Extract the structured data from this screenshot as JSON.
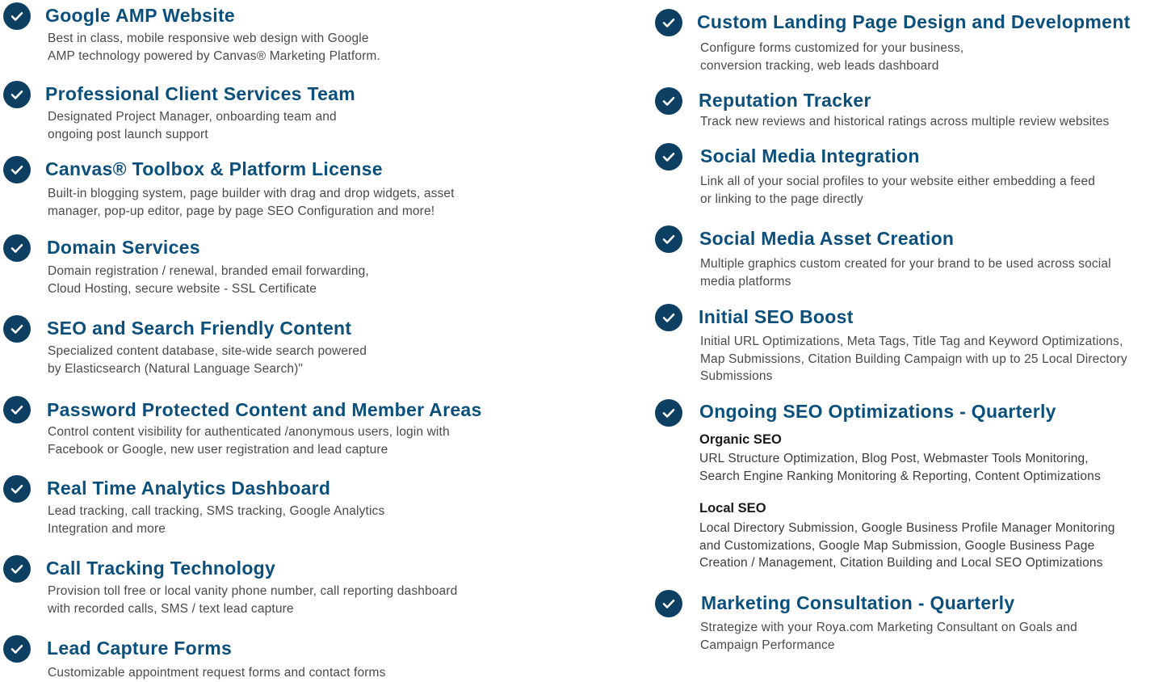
{
  "colors": {
    "check_bg": "#0d3f63",
    "title": "#0b4f7c",
    "text": "#4a4a4a"
  },
  "icon": "checkmark-circle-icon",
  "left_items": [
    {
      "title": "Google AMP Website",
      "desc": [
        "Best in class, mobile responsive web design with Google",
        "AMP technology powered by Canvas® Marketing Platform."
      ]
    },
    {
      "title": "Professional Client Services Team",
      "desc": [
        "Designated Project Manager, onboarding team and",
        "ongoing post launch support"
      ]
    },
    {
      "title": "Canvas® Toolbox & Platform License",
      "desc": [
        "Built-in blogging system, page builder with drag and drop widgets, asset",
        "manager, pop-up editor, page by page SEO Configuration and more!"
      ]
    },
    {
      "title": "Domain Services",
      "desc": [
        "Domain registration / renewal, branded email forwarding,",
        "Cloud Hosting, secure website - SSL Certificate"
      ]
    },
    {
      "title": "SEO and Search Friendly Content",
      "desc": [
        "Specialized content database, site-wide search powered",
        "by Elasticsearch (Natural Language Search)\""
      ]
    },
    {
      "title": "Password Protected Content and Member Areas",
      "desc": [
        "Control content visibility for authenticated /anonymous users, login with",
        "Facebook or Google, new user registration and lead capture"
      ]
    },
    {
      "title": "Real Time Analytics Dashboard",
      "desc": [
        "Lead tracking, call tracking, SMS tracking, Google Analytics",
        "Integration and more"
      ]
    },
    {
      "title": "Call Tracking Technology",
      "desc": [
        "Provision toll free or local vanity phone number, call reporting dashboard",
        "with recorded calls, SMS / text lead capture"
      ]
    },
    {
      "title": "Lead Capture Forms",
      "desc": [
        "Customizable appointment request forms and contact forms"
      ]
    }
  ],
  "right_items": [
    {
      "title": "Custom Landing Page Design and Development",
      "desc": [
        "Configure forms customized for your business,",
        "conversion tracking, web leads dashboard"
      ]
    },
    {
      "title": "Reputation Tracker",
      "desc": [
        "Track new reviews and historical ratings across multiple review websites"
      ]
    },
    {
      "title": "Social Media Integration",
      "desc": [
        "Link all of your social profiles to your website either embedding a feed",
        "or linking to the page directly"
      ]
    },
    {
      "title": "Social Media Asset Creation",
      "desc": [
        "Multiple graphics custom created for your brand to be used across social",
        "media platforms"
      ]
    },
    {
      "title": "Initial SEO Boost",
      "desc": [
        "Initial URL Optimizations, Meta Tags, Title Tag and Keyword Optimizations,",
        "Map Submissions, Citation Building Campaign with up to 25 Local Directory",
        "Submissions"
      ]
    },
    {
      "title": "Ongoing SEO Optimizations - Quarterly",
      "desc": []
    },
    {
      "title": "Marketing Consultation - Quarterly",
      "desc": [
        "Strategize with your Roya.com Marketing Consultant on Goals and",
        "Campaign Performance"
      ]
    }
  ],
  "ongoing_seo": {
    "organic": {
      "title": "Organic SEO",
      "desc": [
        "URL Structure Optimization, Blog Post, Webmaster Tools Monitoring,",
        "Search Engine Ranking Monitoring & Reporting, Content Optimizations"
      ]
    },
    "local": {
      "title": "Local SEO",
      "desc": [
        "Local Directory Submission, Google Business Profile Manager Monitoring",
        "and Customizations, Google Map Submission, Google Business Page",
        "Creation / Management, Citation Building and Local SEO Optimizations"
      ]
    }
  }
}
